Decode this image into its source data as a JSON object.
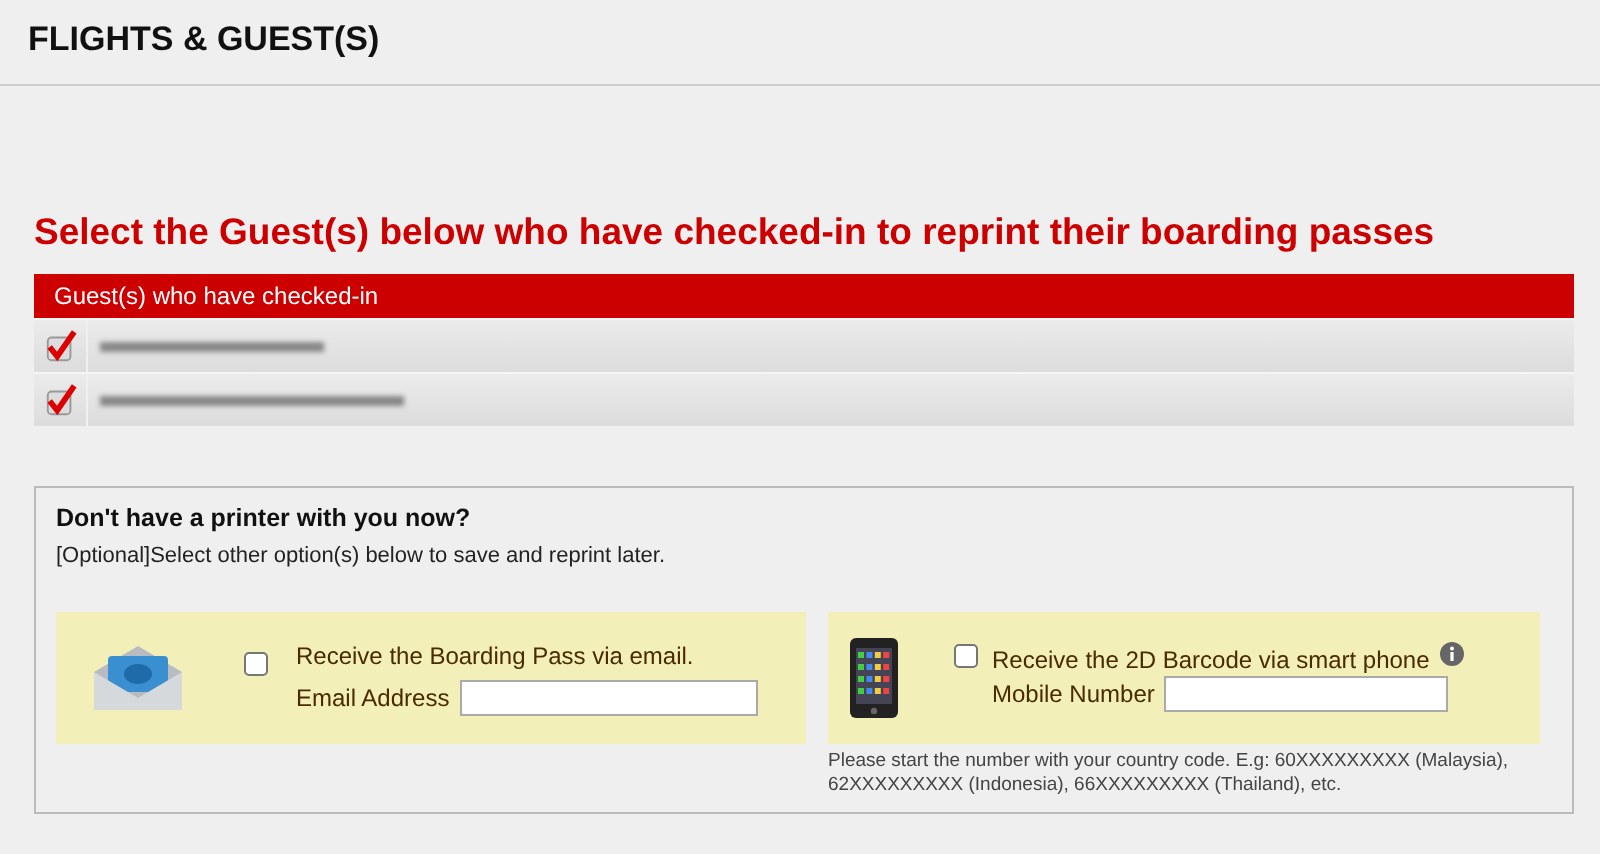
{
  "page_title": "FLIGHTS & GUEST(S)",
  "instruction": "Select the Guest(s) below who have checked-in to reprint their boarding passes",
  "guest_table": {
    "header": "Guest(s) who have checked-in",
    "rows": [
      {
        "checked": true,
        "kind": "redacted"
      },
      {
        "checked": true,
        "kind": "redacted"
      }
    ]
  },
  "printer_box": {
    "title": "Don't have a printer with you now?",
    "subtitle": "[Optional]Select other option(s) below to save and reprint later.",
    "options": [
      {
        "kind": "email",
        "label": "Receive the Boarding Pass via email.",
        "field_label": "Email Address",
        "checked": false
      },
      {
        "kind": "phone",
        "label": "Receive the 2D Barcode via smart phone",
        "field_label": "Mobile Number",
        "checked": false,
        "info": true,
        "note": "Please start the number with your country code. E.g: 60XXXXXXXXX (Malaysia), 62XXXXXXXXX (Indonesia), 66XXXXXXXXX (Thailand), etc."
      }
    ]
  }
}
